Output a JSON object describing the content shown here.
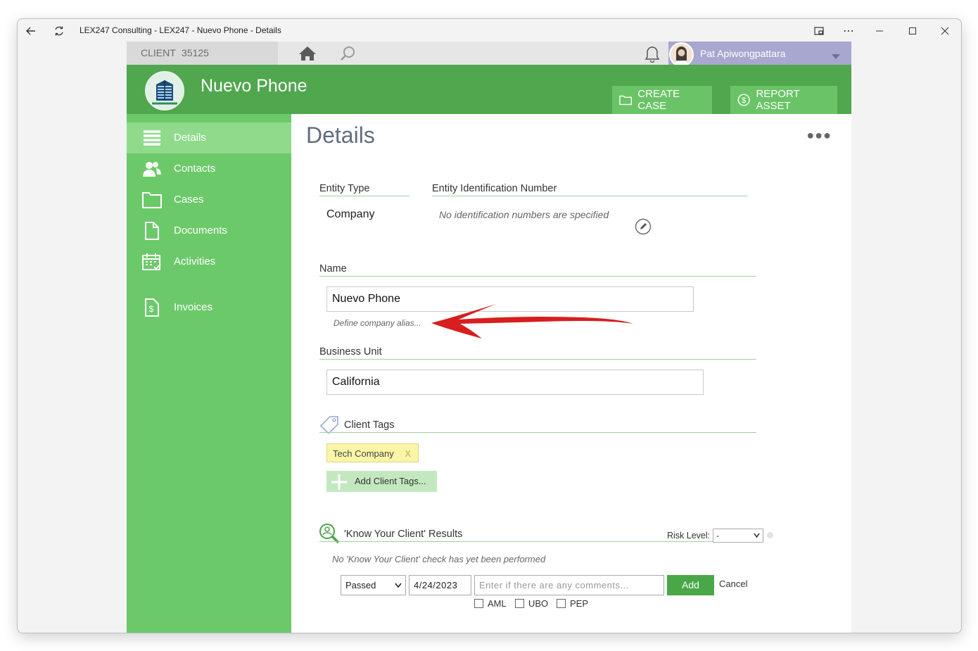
{
  "window": {
    "title": "LEX247 Consulting - LEX247 - Nuevo Phone - Details"
  },
  "topbar": {
    "client_label": "CLIENT",
    "client_number": "35125",
    "user_name": "Pat Apiwongpattara"
  },
  "header": {
    "client_name": "Nuevo Phone",
    "create_case_label": "CREATE CASE",
    "report_asset_label": "REPORT ASSET"
  },
  "sidebar": {
    "items": [
      {
        "label": "Details",
        "icon": "list-icon"
      },
      {
        "label": "Contacts",
        "icon": "people-icon"
      },
      {
        "label": "Cases",
        "icon": "folder-icon"
      },
      {
        "label": "Documents",
        "icon": "document-icon"
      },
      {
        "label": "Activities",
        "icon": "calendar-icon"
      },
      {
        "label": "Invoices",
        "icon": "invoice-icon"
      }
    ]
  },
  "main": {
    "title": "Details",
    "entity_type_label": "Entity Type",
    "entity_type_value": "Company",
    "entity_id_label": "Entity Identification Number",
    "entity_id_value": "No identification numbers are specified",
    "name_label": "Name",
    "name_value": "Nuevo Phone",
    "alias_link": "Define company alias...",
    "business_unit_label": "Business Unit",
    "business_unit_value": "California",
    "client_tags_label": "Client Tags",
    "tags": [
      "Tech Company"
    ],
    "tag_remove": "X",
    "add_tags_label": "Add Client Tags...",
    "kyc_label": "'Know Your Client' Results",
    "risk_level_label": "Risk Level:",
    "risk_level_value": "-",
    "kyc_empty": "No 'Know Your Client' check has yet been performed",
    "kyc_status_value": "Passed",
    "kyc_date_value": "4/24/2023",
    "kyc_comment_placeholder": "Enter if there are any comments...",
    "add_button": "Add",
    "cancel_link": "Cancel",
    "checks": [
      "AML",
      "UBO",
      "PEP"
    ]
  },
  "colors": {
    "header_green": "#50a74e",
    "sidebar_green": "#6cc96a",
    "active_item": "#8fdb8b",
    "tag_yellow": "#fbf6a7",
    "user_bar": "#a7a7d0",
    "annotation_red": "#d81e1e"
  }
}
